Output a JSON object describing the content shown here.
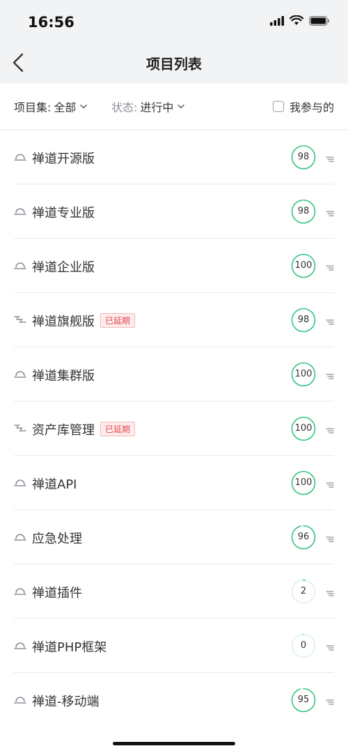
{
  "status_bar": {
    "time": "16:56"
  },
  "nav": {
    "title": "项目列表"
  },
  "filters": {
    "set_label": "项目集:",
    "set_value": "全部",
    "status_label": "状态:",
    "status_value": "进行中",
    "mine_label": "我参与的"
  },
  "colors": {
    "progress": "#2fc27a",
    "progress_track": "#d8f3e5",
    "badge": "#e5484d"
  },
  "projects": [
    {
      "name": "禅道开源版",
      "icon": "scrum-icon",
      "badge": "",
      "progress": 98
    },
    {
      "name": "禅道专业版",
      "icon": "scrum-icon",
      "badge": "",
      "progress": 98
    },
    {
      "name": "禅道企业版",
      "icon": "scrum-icon",
      "badge": "",
      "progress": 100
    },
    {
      "name": "禅道旗舰版",
      "icon": "waterfall-icon",
      "badge": "已延期",
      "progress": 98
    },
    {
      "name": "禅道集群版",
      "icon": "scrum-icon",
      "badge": "",
      "progress": 100
    },
    {
      "name": "资产库管理",
      "icon": "waterfall-icon",
      "badge": "已延期",
      "progress": 100
    },
    {
      "name": "禅道API",
      "icon": "scrum-icon",
      "badge": "",
      "progress": 100
    },
    {
      "name": "应急处理",
      "icon": "scrum-icon",
      "badge": "",
      "progress": 96
    },
    {
      "name": "禅道插件",
      "icon": "scrum-icon",
      "badge": "",
      "progress": 2
    },
    {
      "name": "禅道PHP框架",
      "icon": "scrum-icon",
      "badge": "",
      "progress": 0
    },
    {
      "name": "禅道-移动端",
      "icon": "scrum-icon",
      "badge": "",
      "progress": 95
    }
  ]
}
